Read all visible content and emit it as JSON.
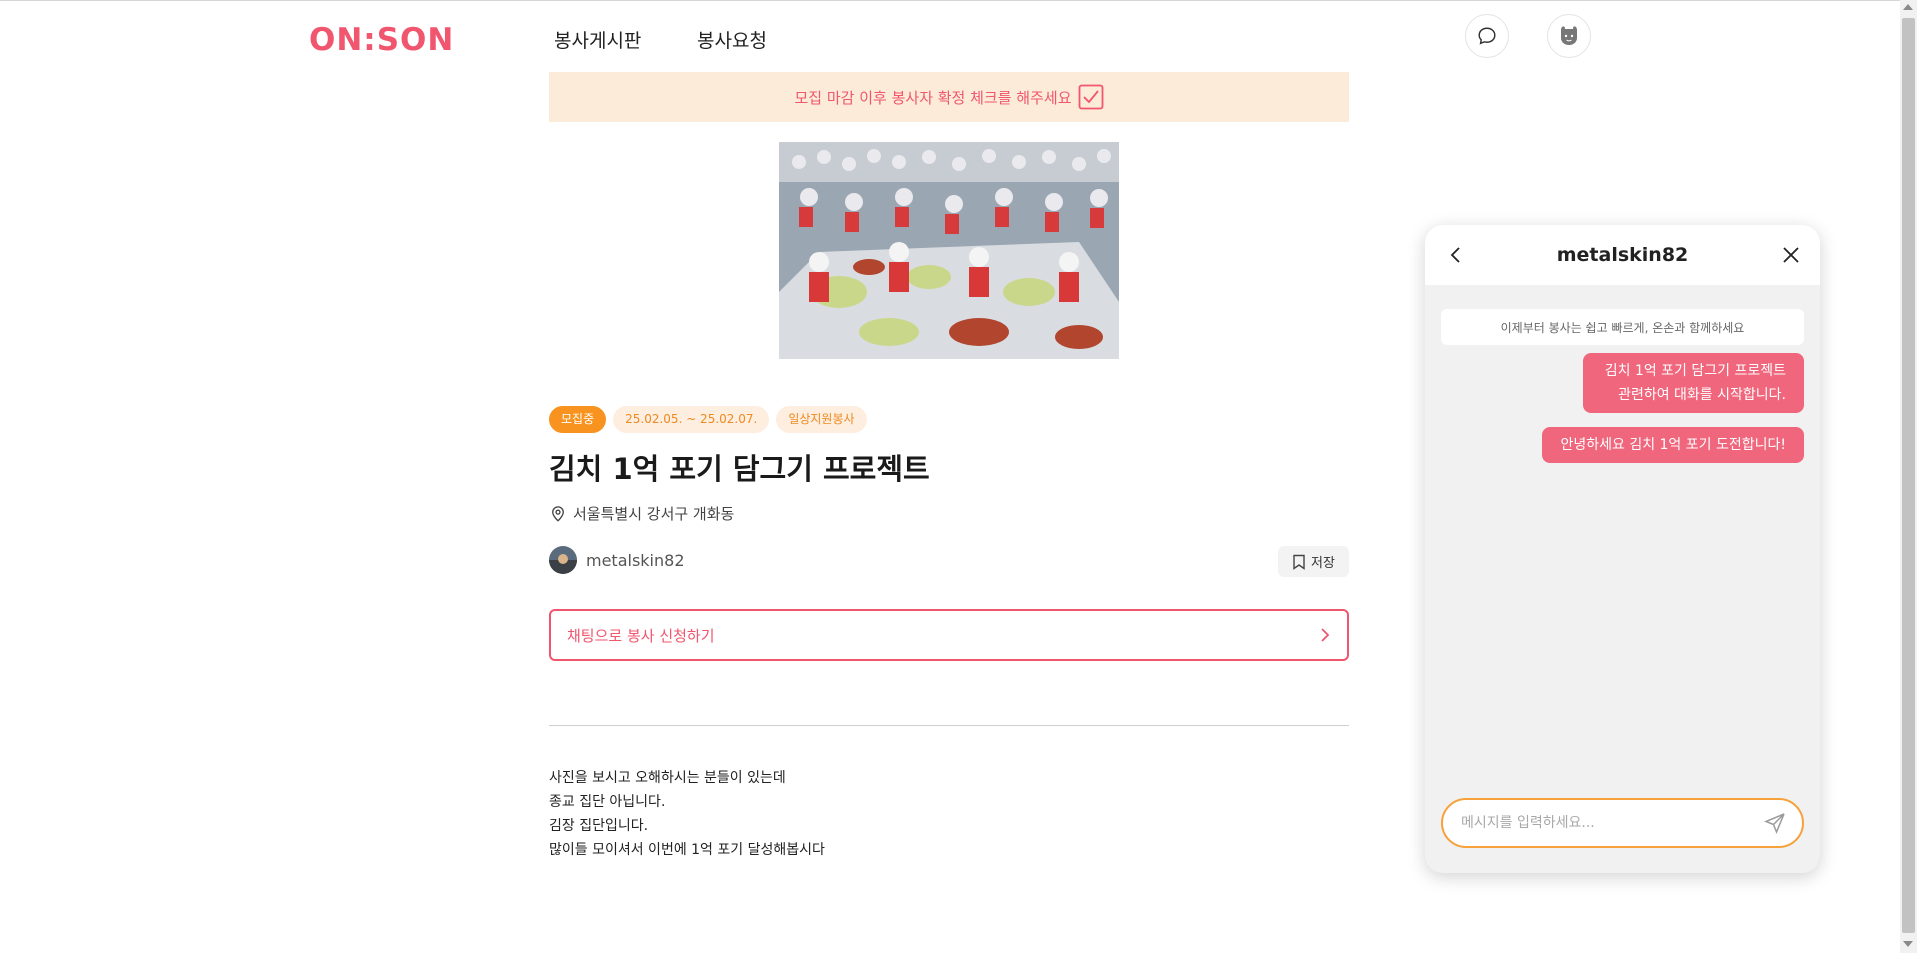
{
  "header": {
    "logo": "ON:SON",
    "nav": [
      {
        "label": "봉사게시판"
      },
      {
        "label": "봉사요청"
      }
    ],
    "chat_icon": "chat-bubble-icon",
    "avatar_icon": "user-avatar-icon"
  },
  "notice": {
    "text": "모집 마감 이후 봉사자 확정 체크를 해주세요",
    "icon": "checkbox-check-icon"
  },
  "post": {
    "image_desc": "kimchi-making-volunteers-photo",
    "tags": [
      {
        "label": "모집중"
      },
      {
        "label": "25.02.05. ~ 25.02.07."
      },
      {
        "label": "일상지원봉사"
      }
    ],
    "title": "김치 1억 포기 담그기 프로젝트",
    "location": "서울특별시 강서구 개화동",
    "author": "metalskin82",
    "save_label": "저장",
    "apply_label": "채팅으로 봉사 신청하기",
    "body": [
      "사진을 보시고 오해하시는 분들이 있는데",
      "종교 집단 아닙니다.",
      "김장 집단입니다.",
      "많이들 모이셔서 이번에 1억 포기 달성해봅시다"
    ]
  },
  "chat": {
    "title": "metalskin82",
    "system_message": "이제부터 봉사는 쉽고 빠르게, 온손과 함께하세요",
    "messages": [
      {
        "text": "김치 1억 포기 담그기 프로젝트 관련하여 대화를 시작합니다."
      },
      {
        "text": "안녕하세요 김치 1억 포기 도전합니다!"
      }
    ],
    "input_placeholder": "메시지를 입력하세요..."
  },
  "colors": {
    "brand": "#f0566d",
    "accent_orange": "#f7931e",
    "notice_bg": "#fdebd9",
    "input_border": "#f6a13a"
  }
}
